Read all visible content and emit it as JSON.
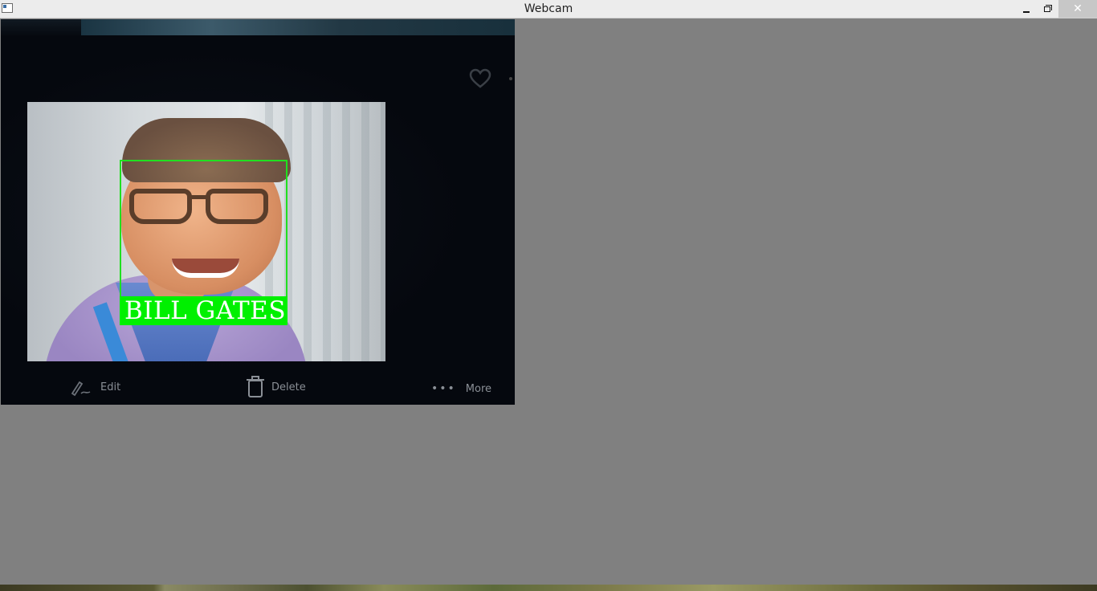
{
  "window": {
    "title": "Webcam",
    "icon": "app-window-icon",
    "controls": {
      "minimize_icon": "minimize-icon",
      "maximize_icon": "restore-icon",
      "close_icon": "close-icon"
    }
  },
  "webcam": {
    "detection": {
      "label": "BILL GATES",
      "box_color": "#20e020",
      "label_bg": "#00f000"
    },
    "phone_screen": {
      "toolbar": {
        "edit_label": "Edit",
        "delete_label": "Delete",
        "more_label": "More"
      }
    }
  },
  "colors": {
    "window_background": "#808080",
    "titlebar": "#ececec"
  }
}
